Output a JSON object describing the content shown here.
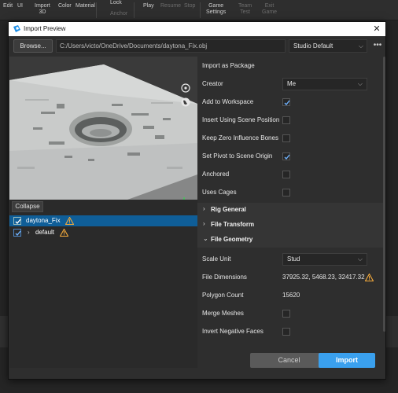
{
  "ribbon": {
    "items": [
      {
        "label": "Edit",
        "dim": false
      },
      {
        "label": "UI",
        "dim": false
      },
      {
        "label": "Import\n3D",
        "dim": false
      },
      {
        "label": "Color",
        "dim": false
      },
      {
        "label": "Material",
        "dim": false
      },
      {
        "label": "Lock",
        "dim": false
      },
      {
        "label": "Anchor",
        "dim": true
      },
      {
        "label": "Play",
        "dim": false
      },
      {
        "label": "Resume",
        "dim": true
      },
      {
        "label": "Stop",
        "dim": true
      },
      {
        "label": "Game\nSettings",
        "dim": false
      },
      {
        "label": "Team\nTest",
        "dim": true
      },
      {
        "label": "Exit\nGame",
        "dim": true
      }
    ]
  },
  "dialog": {
    "title": "Import Preview",
    "close_glyph": "✕",
    "browse_label": "Browse...",
    "file_path": "C:/Users/victo/OneDrive/Documents/daytona_Fix.obj",
    "preset": "Studio Default",
    "more_glyph": "•••",
    "collapse_label": "Collapse",
    "cancel_label": "Cancel",
    "import_label": "Import"
  },
  "tree": [
    {
      "label": "daytona_Fix",
      "checked": true,
      "selected": true,
      "warning": true,
      "expanded": false
    },
    {
      "label": "default",
      "checked": true,
      "selected": false,
      "warning": true,
      "expanded": false
    }
  ],
  "properties": {
    "import_as_package": {
      "label": "Import as Package"
    },
    "creator": {
      "label": "Creator",
      "value": "Me"
    },
    "add_to_workspace": {
      "label": "Add to Workspace",
      "checked": true
    },
    "insert_using_scene_position": {
      "label": "Insert Using Scene Position",
      "checked": false
    },
    "keep_zero_influence_bones": {
      "label": "Keep Zero Influence Bones",
      "checked": false
    },
    "set_pivot_to_scene_origin": {
      "label": "Set Pivot to Scene Origin",
      "checked": true
    },
    "anchored": {
      "label": "Anchored",
      "checked": false
    },
    "uses_cages": {
      "label": "Uses Cages",
      "checked": false
    },
    "sections": {
      "rig_general": "Rig General",
      "file_transform": "File Transform",
      "file_geometry": "File Geometry"
    },
    "scale_unit": {
      "label": "Scale Unit",
      "value": "Stud"
    },
    "file_dimensions": {
      "label": "File Dimensions",
      "value": "37925.32, 5468.23, 32417.32",
      "warning": true
    },
    "polygon_count": {
      "label": "Polygon Count",
      "value": "15620"
    },
    "merge_meshes": {
      "label": "Merge Meshes",
      "checked": false
    },
    "invert_negative_faces": {
      "label": "Invert Negative Faces",
      "checked": false
    }
  },
  "icons": {
    "title": "roblox-studio-icon",
    "warning": "warning-triangle-icon",
    "check": "checkmark-icon",
    "rotate_view": "rotate-view-icon",
    "globe": "globe-icon",
    "axis": "axis-gizmo-icon"
  },
  "colors": {
    "accent": "#3aa0ee",
    "selection": "#0f5e98",
    "warning": "#f2a93b",
    "check": "#6fb2ff"
  }
}
